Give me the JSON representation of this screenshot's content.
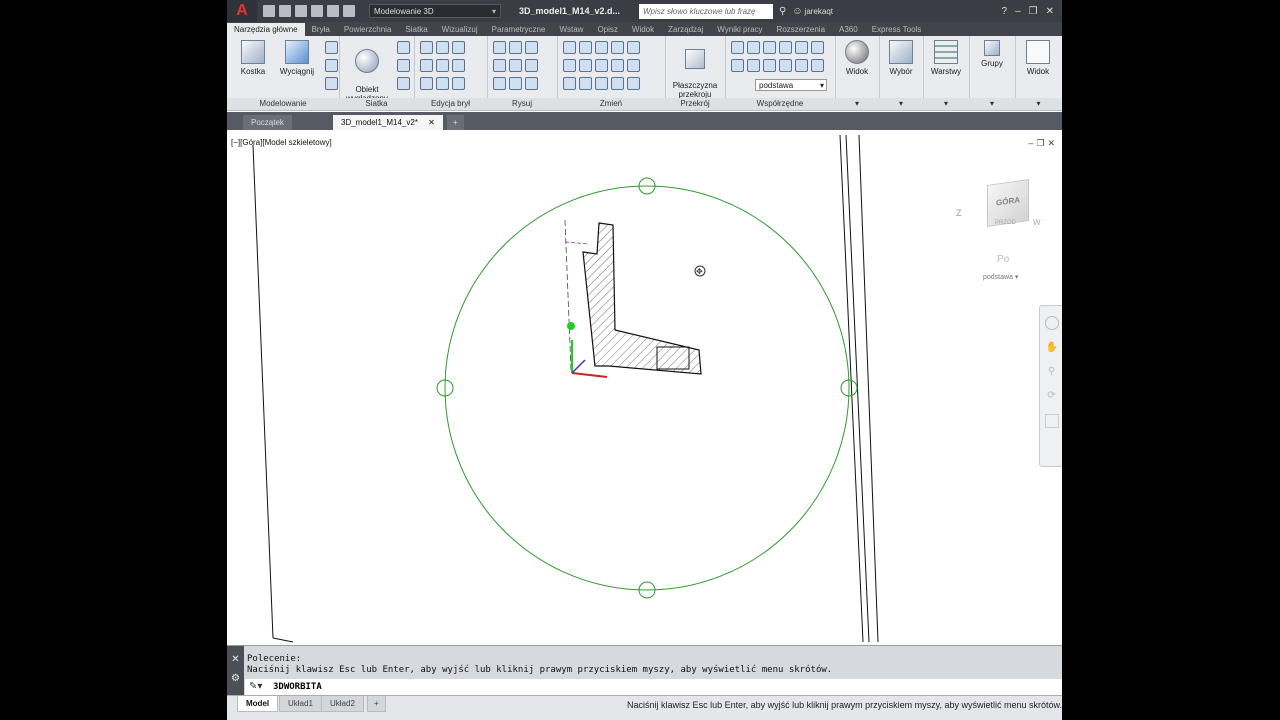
{
  "titlebar": {
    "workspace": "Modelowanie 3D",
    "document_title": "3D_model1_M14_v2.d...",
    "search_placeholder": "Wpisz słowo kluczowe lub frazę",
    "user": "jarekaqt"
  },
  "ribbon_tabs": [
    "Narzędzia główne",
    "Bryła",
    "Powierzchnia",
    "Siatka",
    "Wizualizuj",
    "Parametryczne",
    "Wstaw",
    "Opisz",
    "Widok",
    "Zarządzaj",
    "Wyniki pracy",
    "Rozszerzenia",
    "A360",
    "Express Tools"
  ],
  "ribbon": {
    "kostka": "Kostka",
    "wyciagnij": "Wyciągnij",
    "obiekt_wygladzony": "Obiekt\nwygładzony",
    "plaszczyzna": "Płaszczyzna\nprzekroju",
    "widok": "Widok",
    "wybor": "Wybór",
    "warstwy": "Warstwy",
    "grupy": "Grupy",
    "widok2": "Widok",
    "ucs_combo": "podstawa",
    "panels": {
      "modelowanie": "Modelowanie",
      "siatka": "Siatka",
      "edycja_bryl": "Edycja brył",
      "rysuj": "Rysuj",
      "zmien": "Zmień",
      "przekroj": "Przekrój",
      "wspolrzedne": "Współrzędne"
    }
  },
  "file_tabs": {
    "start": "Początek",
    "drawing": "3D_model1_M14_v2*"
  },
  "viewport": {
    "label": "[−][Góra][Model szkieletowy]",
    "viewcube_top": "GÓRA",
    "viewcube_front": "PRZÓD",
    "viewcube_west": "Z",
    "viewcube_east": "W",
    "ucs_label": "podstawa"
  },
  "command": {
    "line1": "Polecenie:",
    "line2": "Naciśnij klawisz Esc lub Enter, aby wyjść lub kliknij prawym przyciskiem myszy, aby wyświetlić menu skrótów.",
    "input": "3DWORBITA"
  },
  "layout_tabs": [
    "Model",
    "Układ1",
    "Układ2"
  ],
  "status_message": "Naciśnij klawisz Esc lub Enter, aby wyjść lub kliknij prawym przyciskiem myszy, aby wyświetlić menu skrótów.",
  "colors": {
    "orbit": "#2e9a2e",
    "accent": "#e3342f"
  }
}
